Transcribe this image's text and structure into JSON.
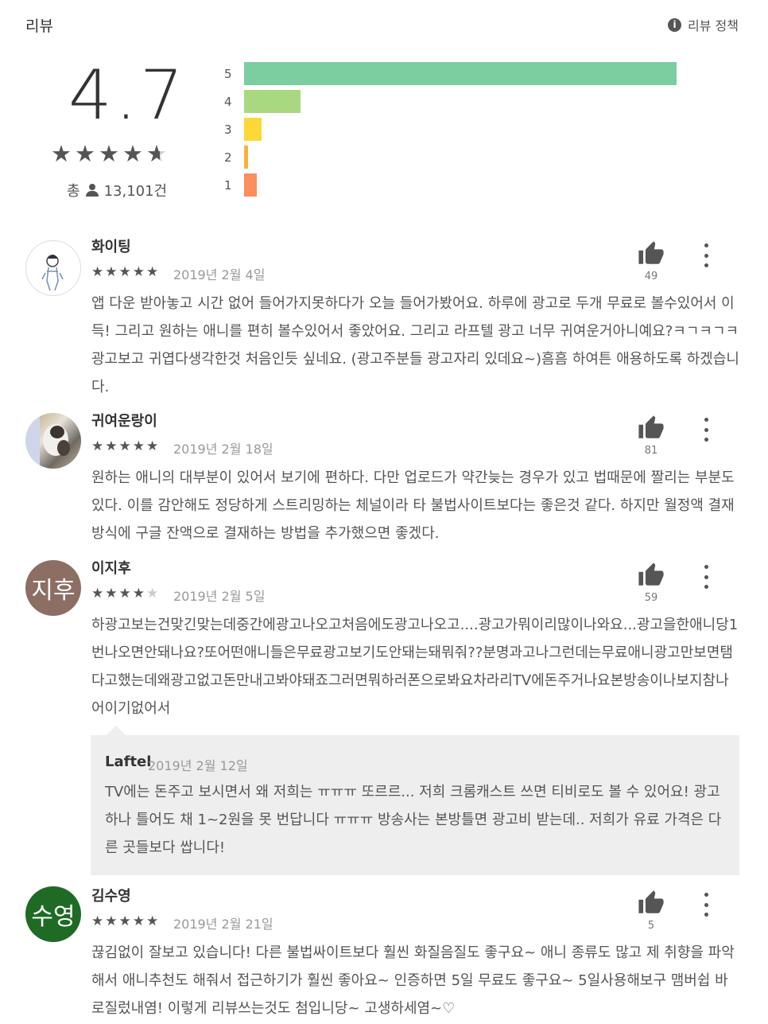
{
  "header": {
    "title": "리뷰",
    "policy_label": "리뷰 정책",
    "policy_icon": "info-icon"
  },
  "summary": {
    "rating": "4.7",
    "stars": "★★★★",
    "total_prefix": "총",
    "total_count": "13,101건",
    "rating_value": 4.7,
    "histogram": [
      {
        "label": "5",
        "share": 1.0,
        "color": "#7ccd9f"
      },
      {
        "label": "4",
        "share": 0.13,
        "color": "#a8d87f"
      },
      {
        "label": "3",
        "share": 0.04,
        "color": "#fdd836"
      },
      {
        "label": "2",
        "share": 0.01,
        "color": "#fbb13a"
      },
      {
        "label": "1",
        "share": 0.03,
        "color": "#fc8d5c"
      }
    ]
  },
  "reviews": [
    {
      "author": "화이팅",
      "date": "2019년 2월 4일",
      "rating": 5,
      "likes": "49",
      "text": "앱 다운 받아놓고 시간 없어 들어가지못하다가 오늘 들어가봤어요. 하루에 광고로 두개 무료로 볼수있어서 이득! 그리고 원하는 애니를 편히 볼수있어서 좋았어요. 그리고 라프텔 광고 너무 귀여운거아니예요?ㅋㄱㅋㄱㅋ 광고보고 귀엽다생각한것 처음인듯 싶네요. (광고주분들 광고자리 있데요~)흠흠 하여튼 애용하도록 하겠습니다."
    },
    {
      "author": "귀여운랑이",
      "date": "2019년 2월 18일",
      "rating": 5,
      "likes": "81",
      "text": "원하는 애니의 대부분이 있어서 보기에 편하다. 다만 업로드가 약간늦는 경우가 있고 법때문에 짤리는 부분도 있다. 이를 감안해도 정당하게 스트리밍하는 체널이라 타 불법사이트보다는 좋은것 같다. 하지만 월정액 결재 방식에 구글 잔액으로 결재하는 방법을 추가했으면 좋겠다."
    },
    {
      "author": "이지후",
      "avatar_text": "지후",
      "avatar_color": "#8d6e63",
      "date": "2019년 2월 5일",
      "rating": 4,
      "likes": "59",
      "text": "하광고보는건맞긴맞는데중간에광고나오고처음에도광고나오고....광고가뭐이리많이나와요...광고을한애니당1번나오면안돼나요?또어떤애니들은무료광고보기도안돼는돼뭐줘??분명과고나그런데는무료애니광고만보면탬다고했는데왜광고없고돈만내고봐야돼죠그러면뭐하러폰으로봐요차라리TV에돈주거나요본방송이나보지참나어이기없어서",
      "reply": {
        "developer": "Laftel",
        "date": "2019년 2월 12일",
        "text": "TV에는 돈주고 보시면서 왜 저희는 ㅠㅠㅠ 또르르... 저희 크롬캐스트 쓰면 티비로도 볼 수 있어요! 광고 하나 틀어도 채 1~2원을 못 번답니다 ㅠㅠㅠ 방송사는 본방틀면 광고비 받는데.. 저희가 유료 가격은 다른 곳들보다 쌉니다!"
      }
    },
    {
      "author": "김수영",
      "avatar_text": "수영",
      "avatar_color": "#1f6b25",
      "date": "2019년 2월 21일",
      "rating": 5,
      "likes": "5",
      "text": "끊김없이 잘보고 있습니다! 다른 불법싸이트보다 훨씬 화질음질도 좋구요~ 애니 종류도 많고 제 취향을 파악해서 애니추천도 해줘서 접근하기가 훨씬 좋아요~ 인증하면 5일 무료도 좋구요~ 5일사용해보구 맴버쉽 바로질렀내염! 이렇게 리뷰쓰는것도 첨입니당~ 고생하세염~♡"
    }
  ],
  "icons": {
    "thumb": "thumbs-up-icon",
    "more": "more-vert-icon",
    "star": "star-icon"
  }
}
